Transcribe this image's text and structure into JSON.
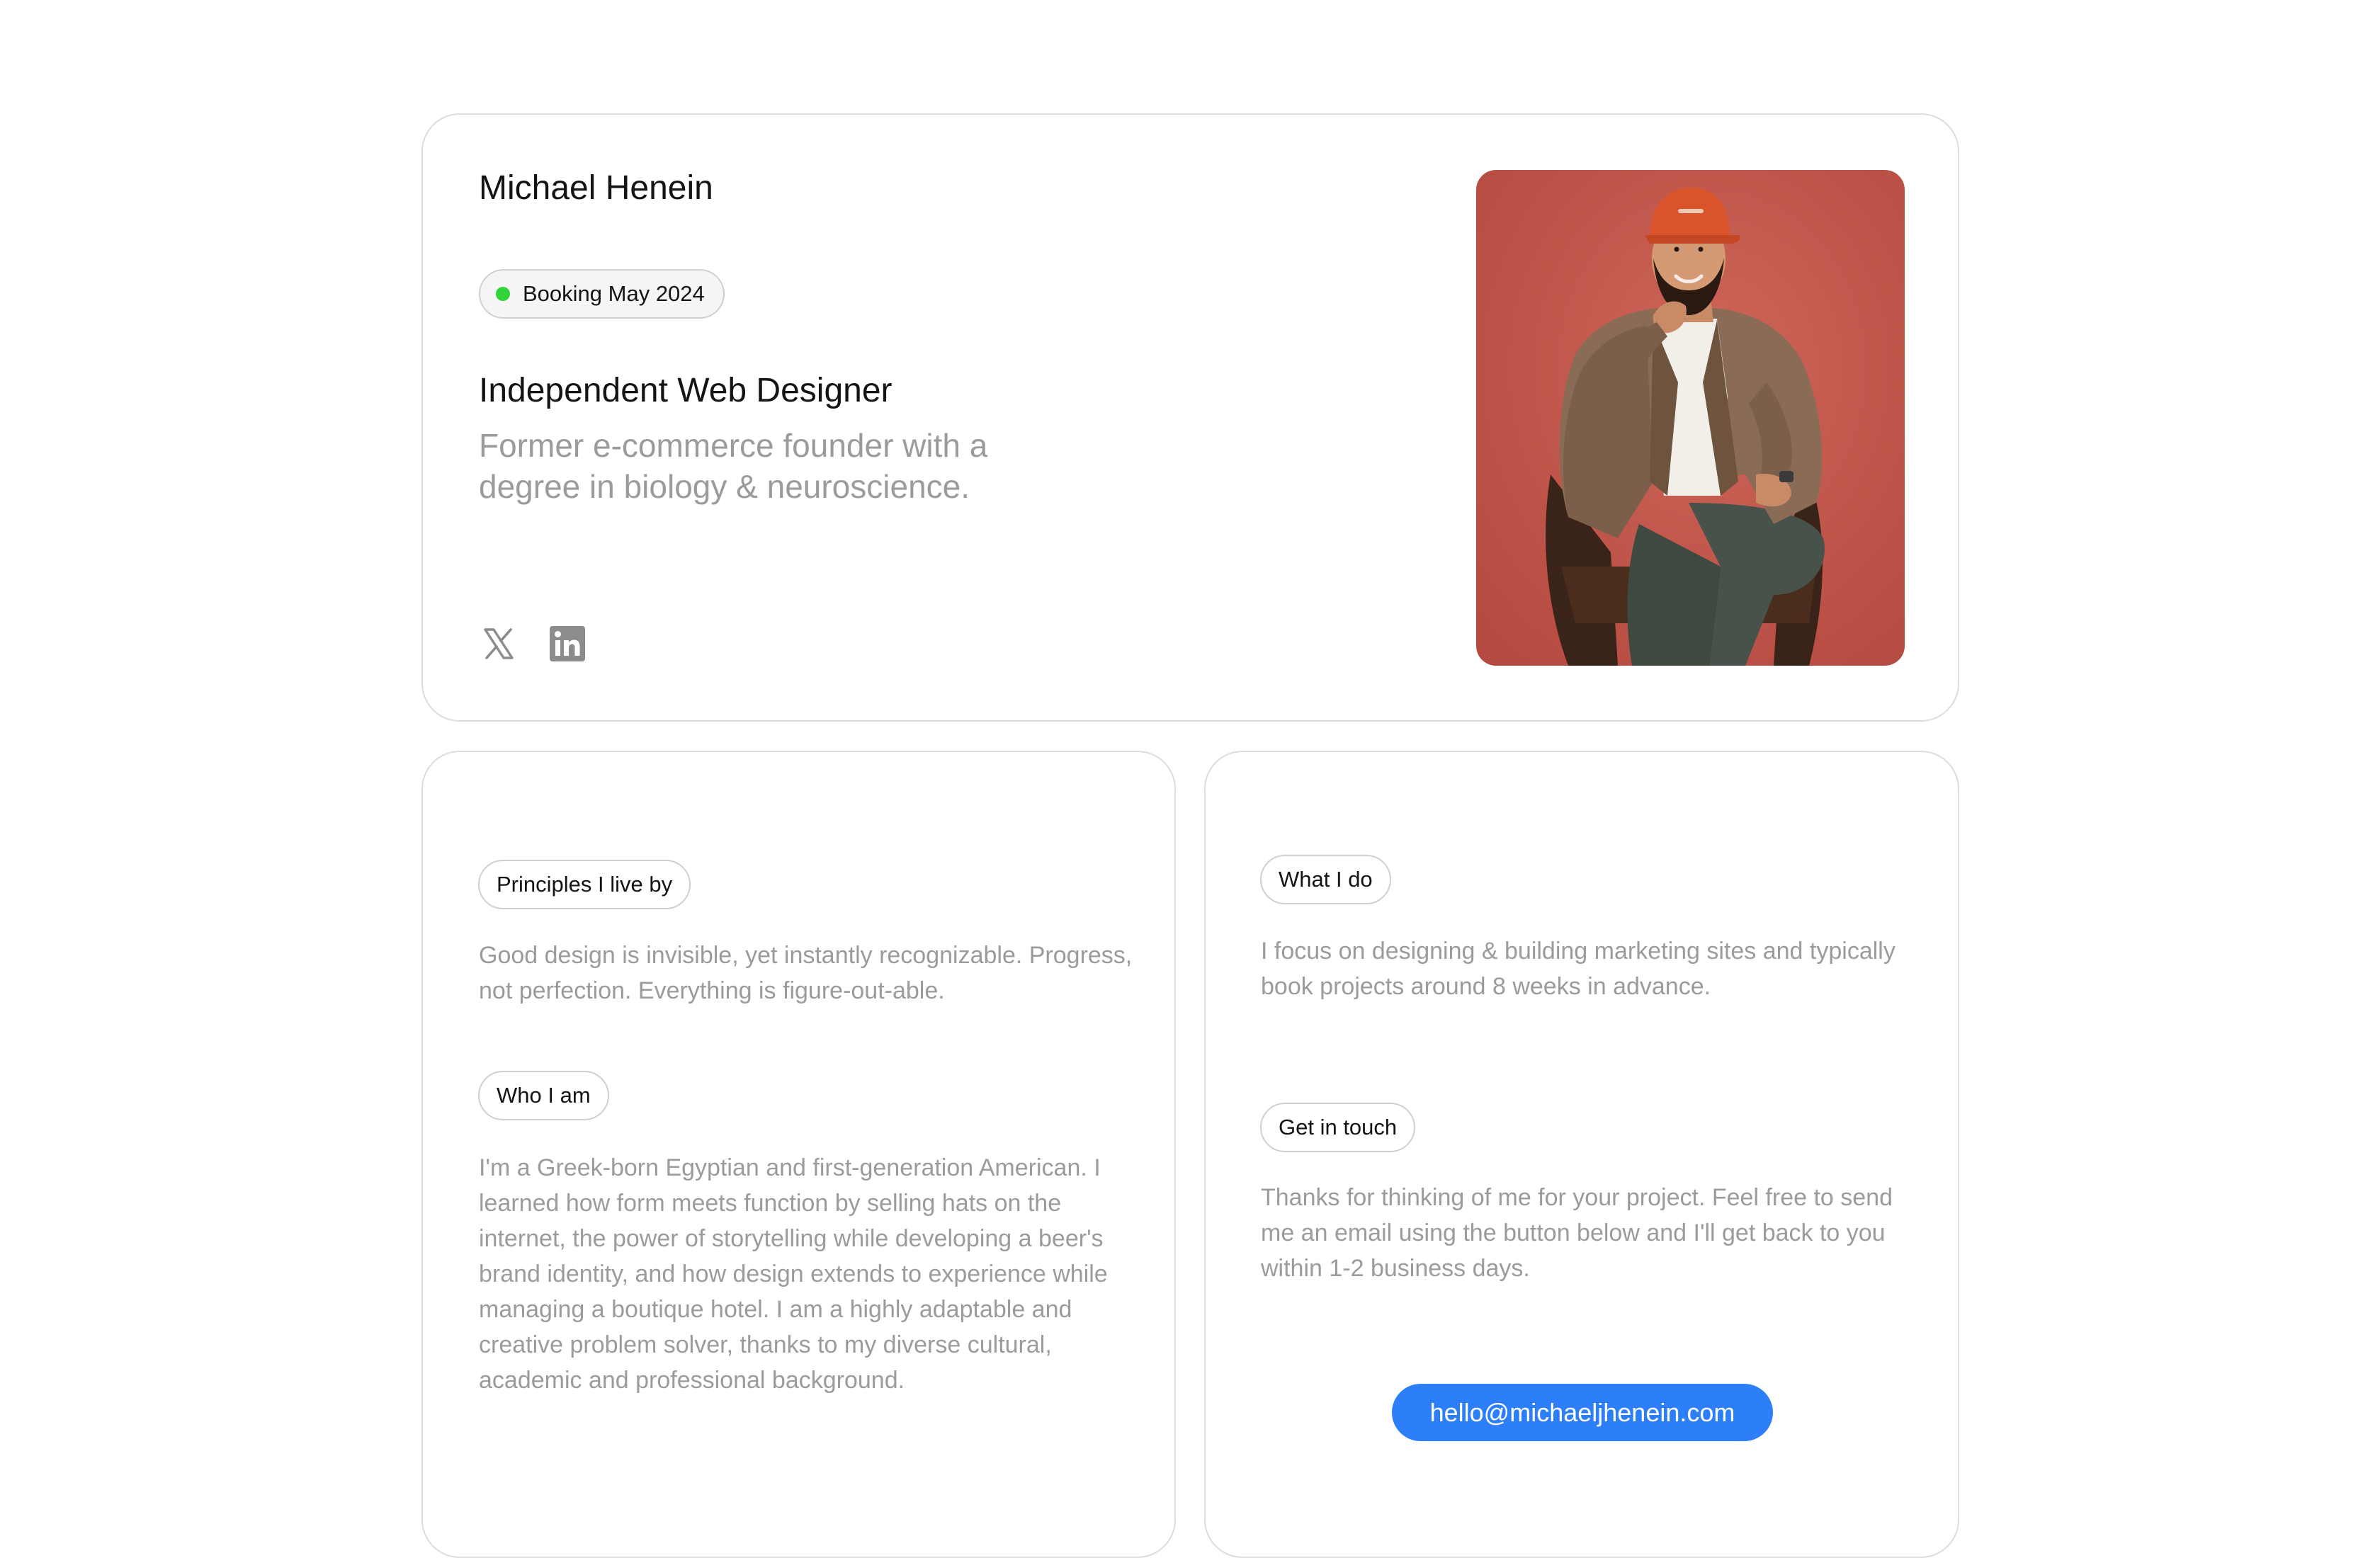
{
  "hero": {
    "name": "Michael Henein",
    "booking_status": "Booking May 2024",
    "role": "Independent Web Designer",
    "tagline": "Former e-commerce founder with a degree in biology & neuroscience.",
    "social_icons": [
      "x-twitter-icon",
      "linkedin-icon"
    ]
  },
  "principles": {
    "label": "Principles I live by",
    "text": "Good design is invisible, yet instantly recognizable. Progress, not perfection. Everything is figure-out-able."
  },
  "about": {
    "label": "Who I am",
    "text": "I'm a Greek-born Egyptian and first-generation American. I learned how form meets function by selling hats on the internet, the power of storytelling while developing a beer's brand identity, and how design extends to experience while managing a boutique hotel. I am a highly adaptable and creative problem solver, thanks to my diverse cultural, academic and professional background."
  },
  "services": {
    "label": "What I do",
    "text": "I focus on designing & building marketing sites and typically book projects around 8 weeks in advance."
  },
  "contact": {
    "label": "Get in touch",
    "text": "Thanks for thinking of me for your project. Feel free to send me an email using the button below and I'll get back to you within 1-2 business days.",
    "email": "hello@michaeljhenein.com"
  },
  "colors": {
    "status_dot": "#33d43a",
    "accent_button": "#2d7ff9",
    "muted_text": "#9b9b9b",
    "photo_background": "#c6574c"
  }
}
